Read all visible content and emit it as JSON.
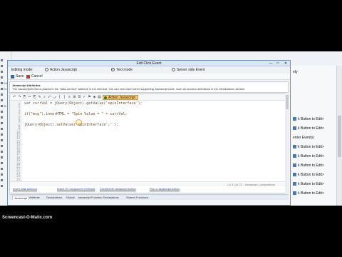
{
  "dialog": {
    "title": "Edit Click Event",
    "min": "—",
    "max": "□",
    "close": "✕"
  },
  "modes": {
    "label": "Editing mode:",
    "options": [
      {
        "label": "Action Javascript",
        "selected": false
      },
      {
        "label": "Text mode",
        "selected": true
      },
      {
        "label": "Server side Event",
        "selected": false
      }
    ]
  },
  "toolbar": {
    "save_label": "Save",
    "cancel_label": "Cancel"
  },
  "info": {
    "title": "Javascript Attributes",
    "description": "The Javascript Event is placed in the \"data-onClick\" attribute in the element. You can now insert other supporting Javascript code, such as function definitions in the Declarations section."
  },
  "editor": {
    "action_button": "Action Javascript",
    "tool_icons": [
      "↶",
      "↷",
      "⎘",
      "✂",
      "⎗",
      "✎",
      "⌕",
      "⤺",
      "⤻",
      "{",
      "}",
      "≡",
      "⊞",
      "☰",
      "✓",
      "⚑",
      "◈",
      "▤"
    ],
    "line_numbers": [
      "1",
      "2",
      "3",
      "4",
      "5",
      "6",
      "7",
      "8",
      "9",
      "10",
      "11",
      "12",
      "13",
      "14",
      "15",
      "16",
      "17",
      "18",
      "19",
      "20",
      "21",
      "22",
      "23",
      "24",
      "25"
    ],
    "lines": [
      "var currVal = jQuery(Object).getValue('spinInterface');",
      "",
      "if(\"msg\").innerHTML = \"Spin Value = \" + currVal;",
      "",
      "jQuery(Object).setValue('spinInterface','');"
    ],
    "status": "Ln 3 Col 22 · Javascript  |  completions"
  },
  "links": [
    "Insert data selector",
    "Insert UI Component methods",
    "Create/edit Javascript Action",
    "Run a Javascript Action"
  ],
  "bottom_tabs": [
    {
      "label": "Javascript",
      "active": true
    },
    {
      "label": "Attribute",
      "active": false
    },
    {
      "label": "Declarations",
      "active": false
    },
    {
      "label": "Global",
      "active": false
    },
    {
      "label": "Javascript Function Declarations",
      "active": false
    },
    {
      "label": "Shared Functions",
      "active": false
    }
  ],
  "background": {
    "left_items": [
      "",
      "",
      "",
      "",
      "Ed",
      "Ex",
      "",
      "",
      "W",
      "",
      "",
      "",
      "",
      "",
      "",
      "",
      "",
      "",
      "",
      "",
      "",
      "",
      ""
    ],
    "right_items": [
      "ety",
      "k Button to Edit>",
      "k Button to Edit>",
      "enter Events)",
      "k Button to Edit>",
      "k Button to Edit>",
      "k Button to Edit>",
      "k Button to Edit>",
      "k Button to Edit>",
      "k Button to Edit>"
    ]
  },
  "watermark": "Screencast-O-Matic.com",
  "colors": {
    "accent": "#f8c86b",
    "title_bar": "#d9e5f3",
    "link": "#1a4fa0"
  }
}
